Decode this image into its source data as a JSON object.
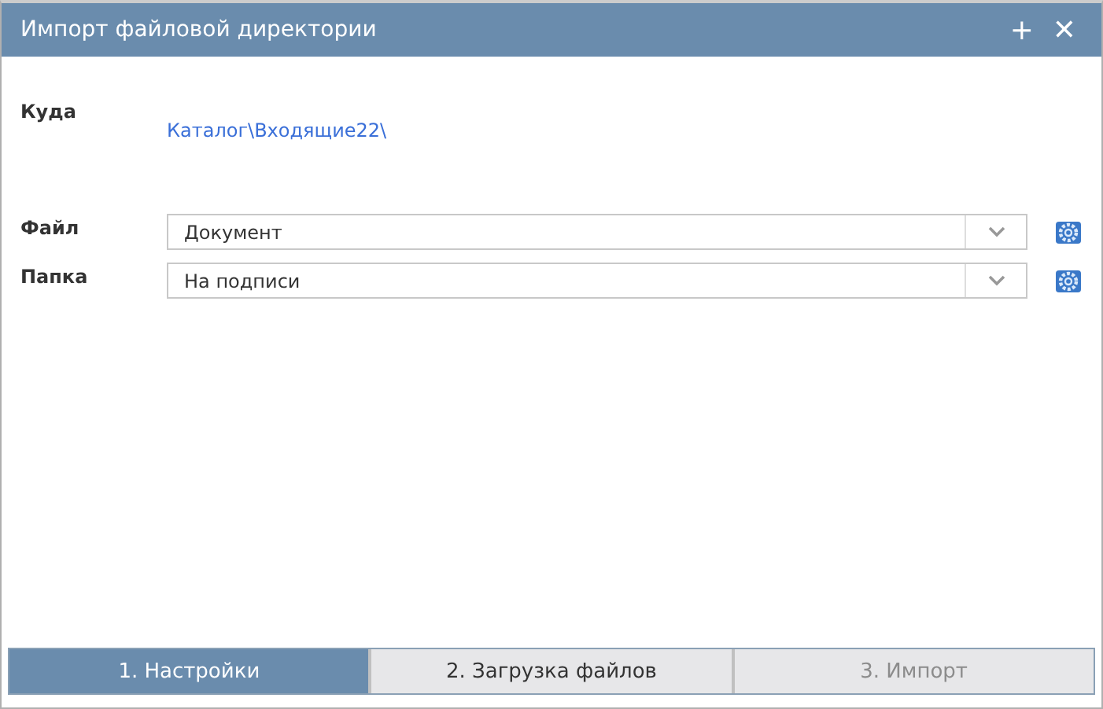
{
  "window": {
    "title": "Импорт файловой директории",
    "buttons": [
      "+",
      "✕"
    ]
  },
  "destination": {
    "label": "Куда",
    "link": "Каталог\\Входящие22\\"
  },
  "fields": [
    {
      "label": "Файл",
      "value": "Документ"
    },
    {
      "label": "Папка",
      "value": "На подписи"
    }
  ],
  "steps": [
    {
      "label": "1. Настройки",
      "selected": true,
      "disabled": false
    },
    {
      "label": "2. Загрузка файлов",
      "selected": false,
      "disabled": false
    },
    {
      "label": "3. Импорт",
      "selected": false,
      "disabled": true
    }
  ]
}
